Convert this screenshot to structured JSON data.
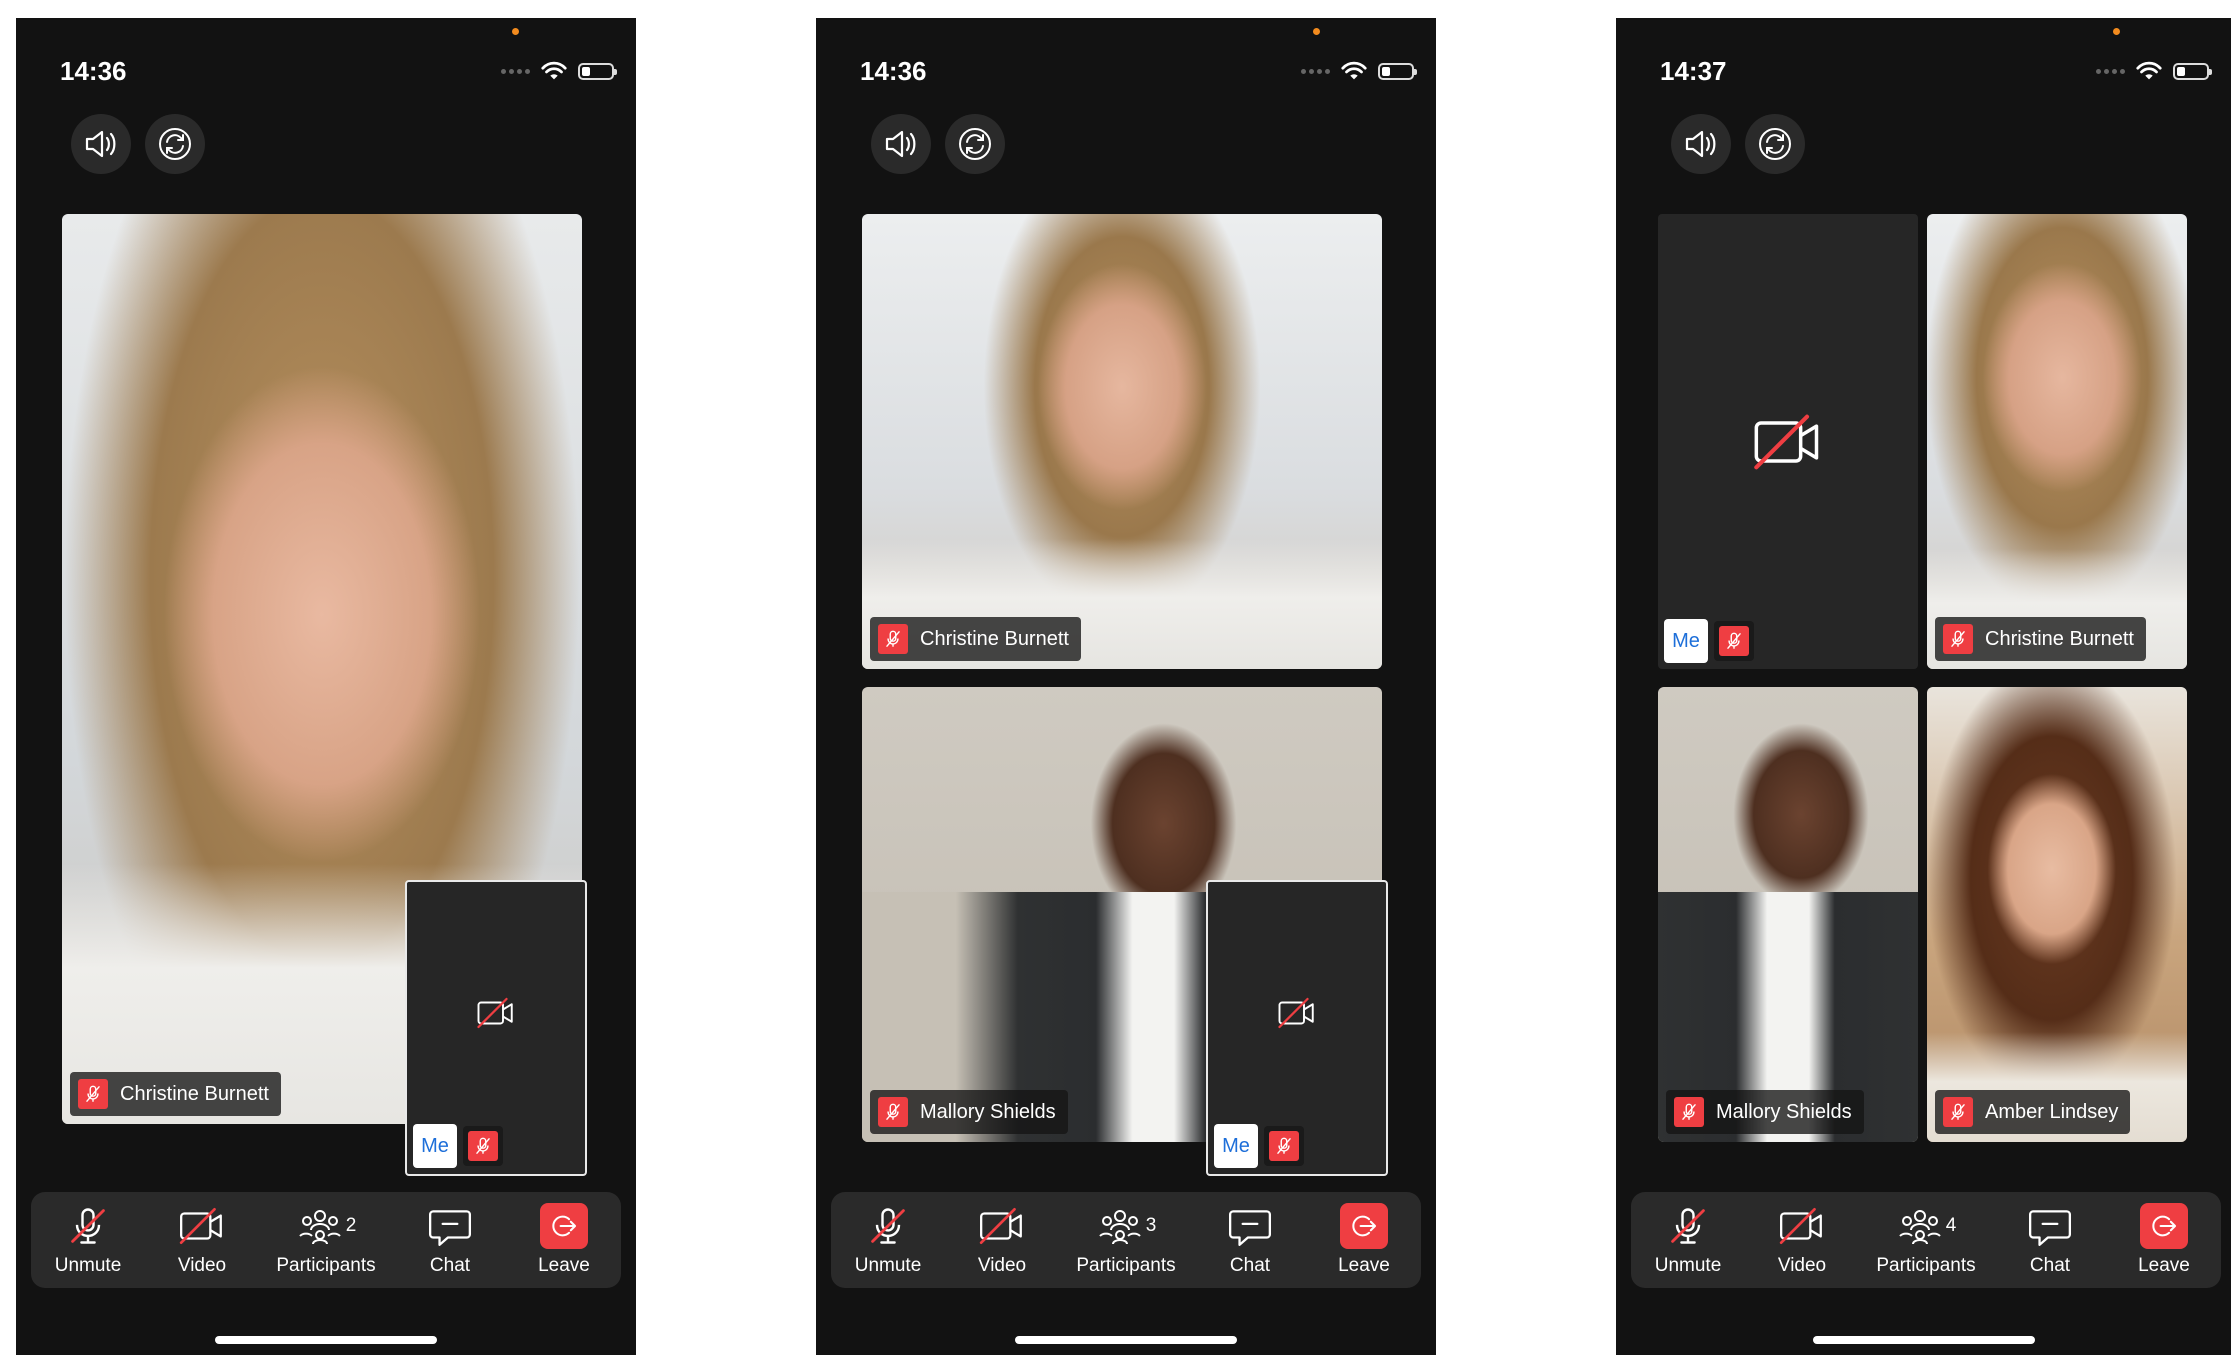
{
  "colors": {
    "background": "#121212",
    "toolbar": "#2a2a2a",
    "leave": "#ef3e42",
    "mic_off": "#ef3e42",
    "me_text": "#1e6fd9"
  },
  "toolbar": {
    "unmute_label": "Unmute",
    "video_label": "Video",
    "participants_label": "Participants",
    "chat_label": "Chat",
    "leave_label": "Leave"
  },
  "screens": [
    {
      "time": "14:36",
      "participant_count": "2",
      "tiles": [
        {
          "name": "Christine Burnett"
        }
      ],
      "me_label": "Me"
    },
    {
      "time": "14:36",
      "participant_count": "3",
      "tiles": [
        {
          "name": "Christine Burnett"
        },
        {
          "name": "Mallory Shields"
        }
      ],
      "me_label": "Me"
    },
    {
      "time": "14:37",
      "participant_count": "4",
      "tiles": [
        {
          "name": "Christine Burnett"
        },
        {
          "name": "Mallory Shields"
        },
        {
          "name": "Amber Lindsey"
        }
      ],
      "me_label": "Me"
    }
  ],
  "icons": [
    "speaker-icon",
    "camera-switch-icon",
    "mic-off-icon",
    "video-off-icon",
    "participants-icon",
    "chat-icon",
    "leave-icon",
    "wifi-icon",
    "battery-icon"
  ]
}
